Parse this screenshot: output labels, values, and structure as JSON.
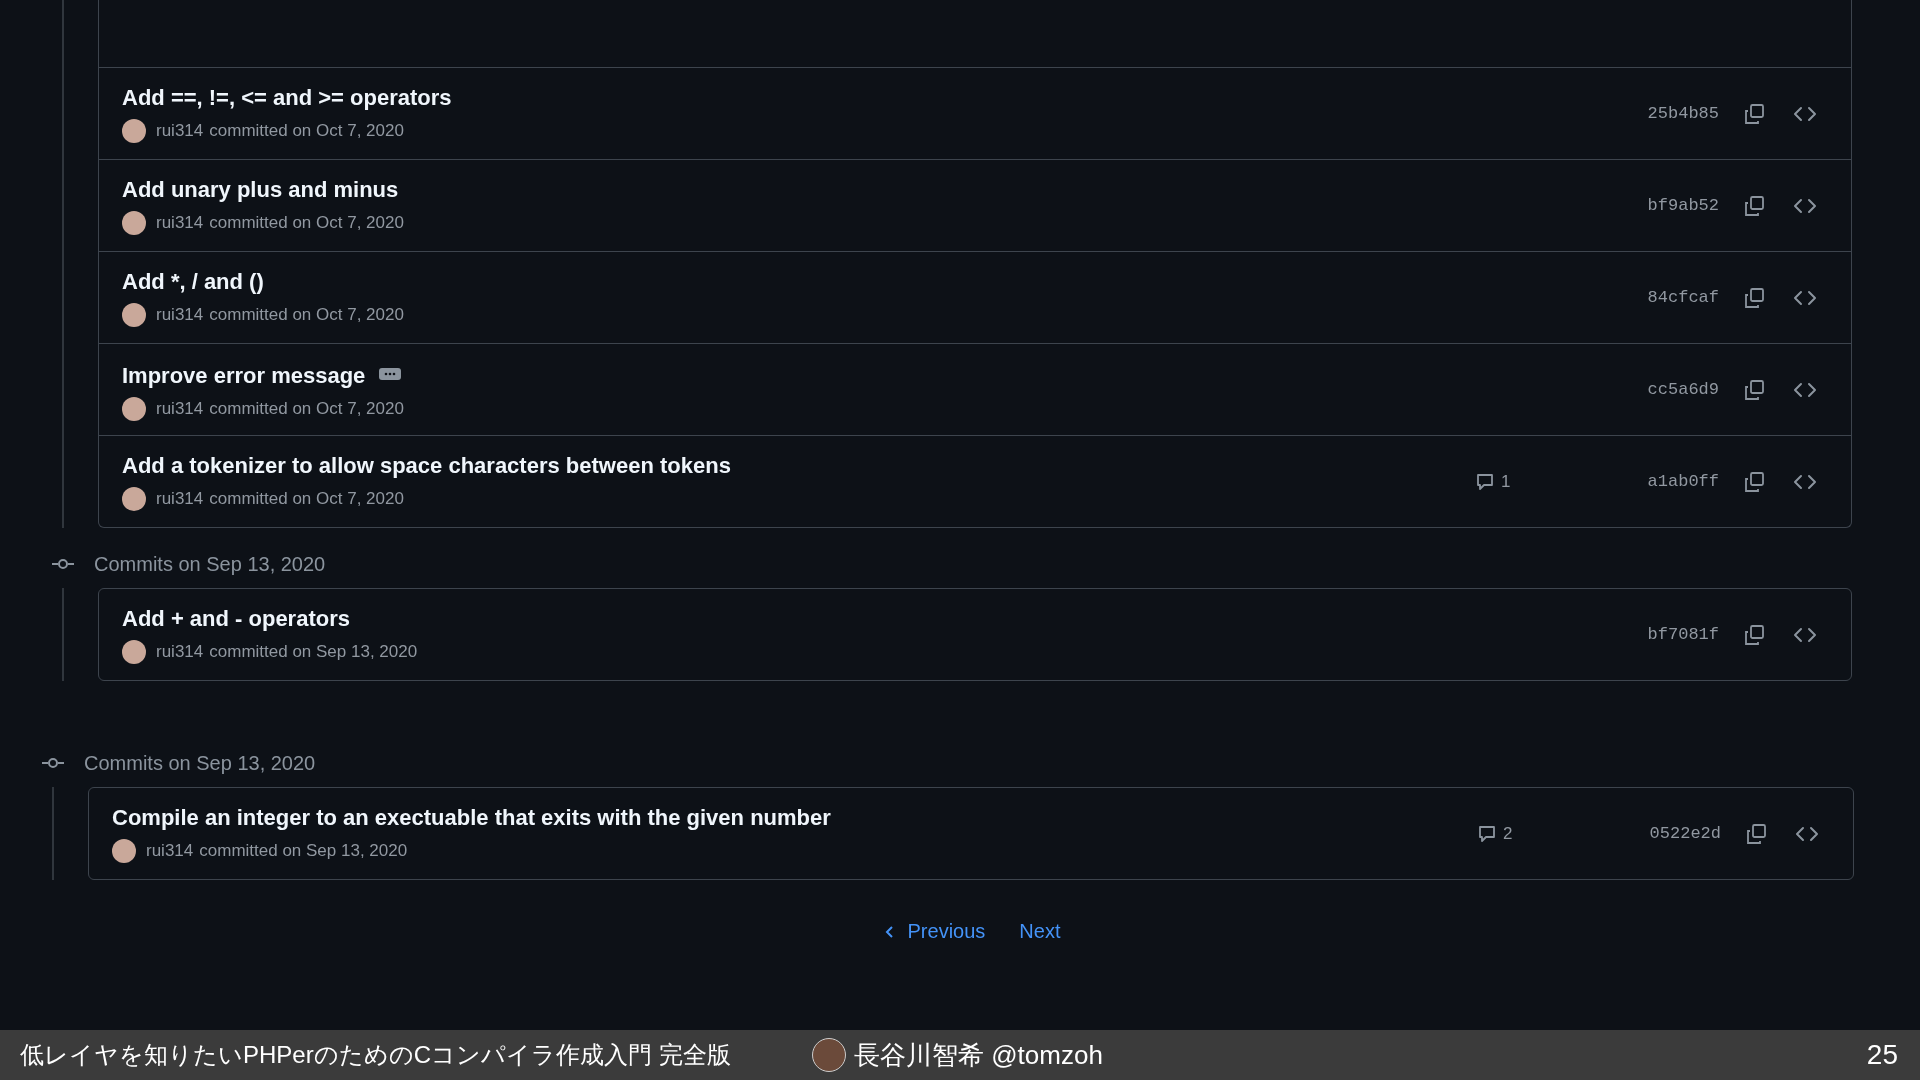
{
  "groups": [
    {
      "commits": [
        {
          "title": "Add ==, !=, <= and >= operators",
          "author": "rui314",
          "committed": "committed on Oct 7, 2020",
          "hash": "25b4b85",
          "expandable": false
        },
        {
          "title": "Add unary plus and minus",
          "author": "rui314",
          "committed": "committed on Oct 7, 2020",
          "hash": "bf9ab52",
          "expandable": false
        },
        {
          "title": "Add *, / and ()",
          "author": "rui314",
          "committed": "committed on Oct 7, 2020",
          "hash": "84cfcaf",
          "expandable": false
        },
        {
          "title": "Improve error message",
          "author": "rui314",
          "committed": "committed on Oct 7, 2020",
          "hash": "cc5a6d9",
          "expandable": true
        },
        {
          "title": "Add a tokenizer to allow space characters between tokens",
          "author": "rui314",
          "committed": "committed on Oct 7, 2020",
          "hash": "a1ab0ff",
          "comments": "1",
          "expandable": false
        }
      ]
    },
    {
      "header": "Commits on Sep 13, 2020",
      "commits": [
        {
          "title": "Add + and - operators",
          "author": "rui314",
          "committed": "committed on Sep 13, 2020",
          "hash": "bf7081f",
          "expandable": false
        }
      ]
    },
    {
      "header": "Commits on Sep 13, 2020",
      "commits": [
        {
          "title": "Compile an integer to an exectuable that exits with the given number",
          "author": "rui314",
          "committed": "committed on Sep 13, 2020",
          "hash": "0522e2d",
          "comments": "2",
          "expandable": false
        }
      ]
    }
  ],
  "pagination": {
    "previous": "Previous",
    "next": "Next"
  },
  "footer": {
    "title": "低レイヤを知りたいPHPerのためのCコンパイラ作成入門 完全版",
    "speaker": "長谷川智希 @tomzoh",
    "page": "25"
  }
}
